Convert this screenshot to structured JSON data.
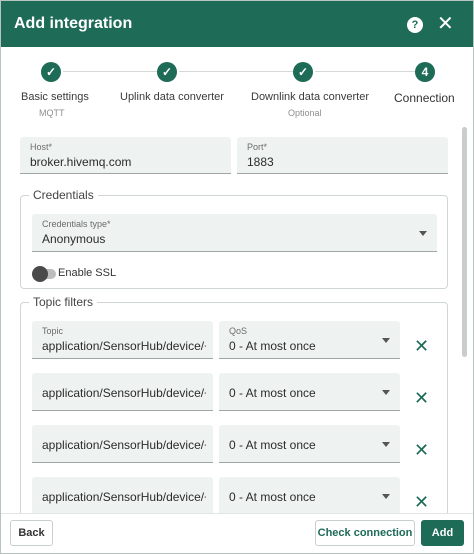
{
  "dialog": {
    "title": "Add integration",
    "help_icon": "question-icon",
    "close_icon": "close-icon",
    "close_glyph": "✕",
    "help_glyph": "?"
  },
  "stepper": {
    "steps": [
      {
        "label": "Basic settings",
        "sublabel": "MQTT",
        "state": "done",
        "glyph": "✓"
      },
      {
        "label": "Uplink data converter",
        "sublabel": "",
        "state": "done",
        "glyph": "✓"
      },
      {
        "label": "Downlink data converter",
        "sublabel": "Optional",
        "state": "done",
        "glyph": "✓"
      },
      {
        "label": "Connection",
        "sublabel": "",
        "state": "active",
        "glyph": "4"
      }
    ]
  },
  "connection": {
    "host": {
      "label": "Host*",
      "value": "broker.hivemq.com"
    },
    "port": {
      "label": "Port*",
      "value": "1883"
    }
  },
  "credentials": {
    "legend": "Credentials",
    "type": {
      "label": "Credentials type*",
      "value": "Anonymous"
    },
    "ssl": {
      "label": "Enable SSL",
      "enabled": false
    }
  },
  "topic_filters": {
    "legend": "Topic filters",
    "topic_label": "Topic",
    "qos_label": "QoS",
    "remove_glyph": "✕",
    "rows": [
      {
        "topic": "application/SensorHub/device/+",
        "qos": "0 - At most once"
      },
      {
        "topic": "application/SensorHub/device/+",
        "qos": "0 - At most once"
      },
      {
        "topic": "application/SensorHub/device/+",
        "qos": "0 - At most once"
      },
      {
        "topic": "application/SensorHub/device/+",
        "qos": "0 - At most once"
      }
    ]
  },
  "footer": {
    "back_label": "Back",
    "check_label": "Check connection",
    "add_label": "Add"
  },
  "colors": {
    "primary": "#1e6b57",
    "field_bg": "#eef3f2"
  }
}
